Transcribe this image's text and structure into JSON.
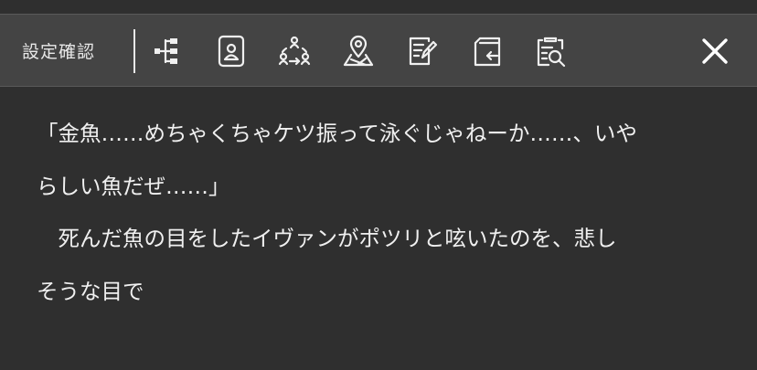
{
  "header": {
    "title": "設定確認"
  },
  "toolbar": {
    "icons": [
      "tree-structure-icon",
      "contact-card-icon",
      "people-relations-icon",
      "map-pin-icon",
      "edit-note-icon",
      "import-into-box-icon",
      "document-search-icon"
    ],
    "close_icon": "close-icon"
  },
  "content": {
    "lines": [
      "「金魚……めちゃくちゃケツ振って泳ぐじゃねーか……、いや",
      "らしい魚だぜ……」",
      "　死んだ魚の目をしたイヴァンがポツリと呟いたのを、悲し",
      "そうな目で"
    ]
  },
  "colors": {
    "background": "#2f2f2f",
    "toolbar": "#444444",
    "text": "#f0f0f0"
  }
}
